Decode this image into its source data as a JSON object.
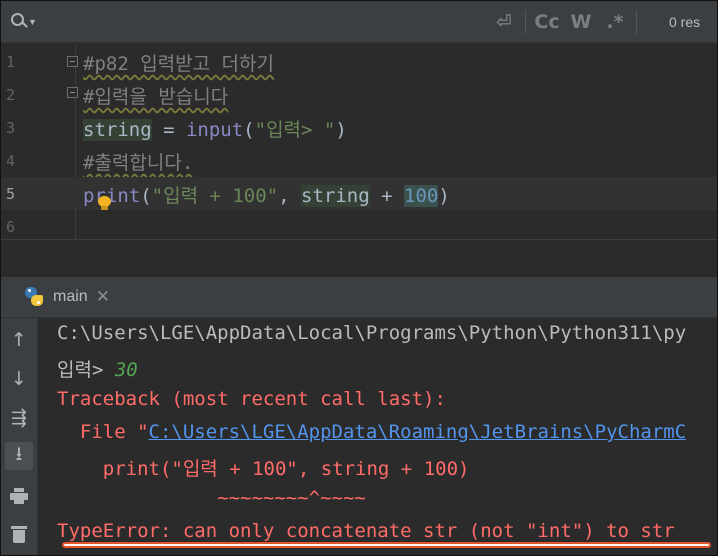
{
  "toolbar": {
    "icons": [
      "search-icon",
      "newline-icon",
      "match-case-icon",
      "whole-word-icon",
      "regex-icon"
    ],
    "match_case_label": "Cc",
    "whole_word_label": "W",
    "regex_label": ".*",
    "result_count": "0 res"
  },
  "editor": {
    "current_line": 5,
    "lines": [
      {
        "num": "1",
        "comment": "#p82 입력받고 더하기"
      },
      {
        "num": "2",
        "comment": "#입력을 받습니다"
      },
      {
        "num": "3",
        "var": "string",
        "op": " = ",
        "func": "input",
        "open": "(",
        "str": "\"입력> \"",
        "close": ")"
      },
      {
        "num": "4",
        "comment": "#출력합니다."
      },
      {
        "num": "5",
        "func": "print",
        "open": "(",
        "str": "\"입력 + 100\"",
        "comma": ", ",
        "var": "string",
        "op": " + ",
        "number": "100",
        "close": ")"
      },
      {
        "num": "6"
      }
    ]
  },
  "run": {
    "tab_label": "main",
    "side_icons": [
      "arrow-up-icon",
      "arrow-down-icon",
      "soft-wrap-icon",
      "scroll-to-end-icon",
      "print-icon",
      "trash-icon"
    ],
    "console": {
      "path": "C:\\Users\\LGE\\AppData\\Local\\Programs\\Python\\Python311\\py",
      "prompt": "입력> ",
      "input_value": "30",
      "traceback": "Traceback (most recent call last):",
      "file_prefix": "  File \"",
      "file_link": "C:\\Users\\LGE\\AppData\\Roaming\\JetBrains\\PyCharmC",
      "code_line": "    print(\"입력 + 100\", string + 100)",
      "carets": "              ~~~~~~~~^~~~~",
      "error": "TypeError: can only concatenate str (not \"int\") to str"
    }
  },
  "colors": {
    "background": "#2b2b2b",
    "panel": "#3c3f41",
    "error": "#ff6b68",
    "link": "#5394ec",
    "string": "#6a8759",
    "keyword": "#8888c6",
    "number": "#6897bb",
    "annotation": "#e2542c"
  }
}
